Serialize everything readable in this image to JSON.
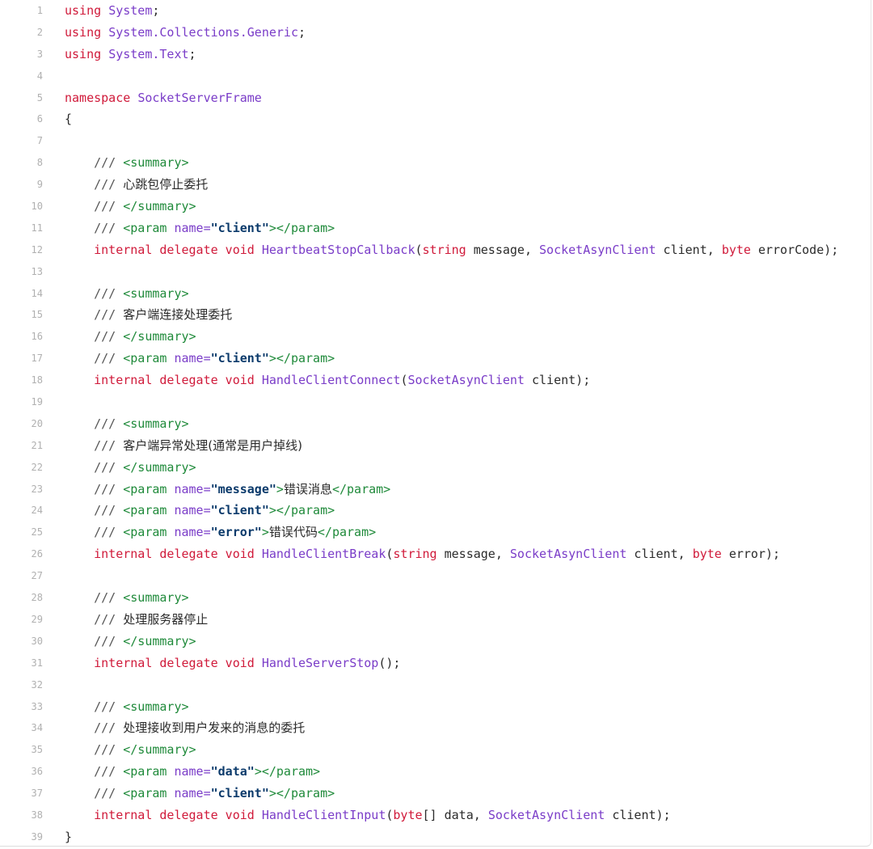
{
  "editor": {
    "language": "csharp",
    "colors": {
      "keyword": "#d01a3a",
      "type": "#7a3cc8",
      "doc_tag": "#1f8a3a",
      "string": "#0b3a6b",
      "line_number": "#b0b0b0",
      "text": "#2b2b2b"
    },
    "lines": [
      {
        "n": "1",
        "tokens": [
          {
            "t": "kw",
            "v": "using"
          },
          {
            "t": "id",
            "v": " "
          },
          {
            "t": "ns",
            "v": "System"
          },
          {
            "t": "punc",
            "v": ";"
          }
        ]
      },
      {
        "n": "2",
        "tokens": [
          {
            "t": "kw",
            "v": "using"
          },
          {
            "t": "id",
            "v": " "
          },
          {
            "t": "ns",
            "v": "System.Collections.Generic"
          },
          {
            "t": "punc",
            "v": ";"
          }
        ]
      },
      {
        "n": "3",
        "tokens": [
          {
            "t": "kw",
            "v": "using"
          },
          {
            "t": "id",
            "v": " "
          },
          {
            "t": "ns",
            "v": "System.Text"
          },
          {
            "t": "punc",
            "v": ";"
          }
        ]
      },
      {
        "n": "4",
        "tokens": []
      },
      {
        "n": "5",
        "tokens": [
          {
            "t": "kw",
            "v": "namespace"
          },
          {
            "t": "id",
            "v": " "
          },
          {
            "t": "ns",
            "v": "SocketServerFrame"
          }
        ]
      },
      {
        "n": "6",
        "tokens": [
          {
            "t": "punc",
            "v": "{"
          }
        ]
      },
      {
        "n": "7",
        "tokens": []
      },
      {
        "n": "8",
        "tokens": [
          {
            "t": "doc",
            "v": "    /// "
          },
          {
            "t": "tag",
            "v": "<summary>"
          }
        ]
      },
      {
        "n": "9",
        "tokens": [
          {
            "t": "doc",
            "v": "    /// "
          },
          {
            "t": "cn",
            "v": "心跳包停止委托"
          }
        ]
      },
      {
        "n": "10",
        "tokens": [
          {
            "t": "doc",
            "v": "    /// "
          },
          {
            "t": "tag",
            "v": "</summary>"
          }
        ]
      },
      {
        "n": "11",
        "tokens": [
          {
            "t": "doc",
            "v": "    /// "
          },
          {
            "t": "tag",
            "v": "<param "
          },
          {
            "t": "attr",
            "v": "name="
          },
          {
            "t": "str",
            "v": "\"client\""
          },
          {
            "t": "tag",
            "v": "></param>"
          }
        ]
      },
      {
        "n": "12",
        "tokens": [
          {
            "t": "id",
            "v": "    "
          },
          {
            "t": "kw",
            "v": "internal delegate void"
          },
          {
            "t": "id",
            "v": " "
          },
          {
            "t": "fn",
            "v": "HeartbeatStopCallback"
          },
          {
            "t": "punc",
            "v": "("
          },
          {
            "t": "kw",
            "v": "string"
          },
          {
            "t": "id",
            "v": " message, "
          },
          {
            "t": "type",
            "v": "SocketAsynClient"
          },
          {
            "t": "id",
            "v": " client, "
          },
          {
            "t": "kw",
            "v": "byte"
          },
          {
            "t": "id",
            "v": " errorCode);"
          }
        ]
      },
      {
        "n": "13",
        "tokens": []
      },
      {
        "n": "14",
        "tokens": [
          {
            "t": "doc",
            "v": "    /// "
          },
          {
            "t": "tag",
            "v": "<summary>"
          }
        ]
      },
      {
        "n": "15",
        "tokens": [
          {
            "t": "doc",
            "v": "    /// "
          },
          {
            "t": "cn",
            "v": "客户端连接处理委托"
          }
        ]
      },
      {
        "n": "16",
        "tokens": [
          {
            "t": "doc",
            "v": "    /// "
          },
          {
            "t": "tag",
            "v": "</summary>"
          }
        ]
      },
      {
        "n": "17",
        "tokens": [
          {
            "t": "doc",
            "v": "    /// "
          },
          {
            "t": "tag",
            "v": "<param "
          },
          {
            "t": "attr",
            "v": "name="
          },
          {
            "t": "str",
            "v": "\"client\""
          },
          {
            "t": "tag",
            "v": "></param>"
          }
        ]
      },
      {
        "n": "18",
        "tokens": [
          {
            "t": "id",
            "v": "    "
          },
          {
            "t": "kw",
            "v": "internal delegate void"
          },
          {
            "t": "id",
            "v": " "
          },
          {
            "t": "fn",
            "v": "HandleClientConnect"
          },
          {
            "t": "punc",
            "v": "("
          },
          {
            "t": "type",
            "v": "SocketAsynClient"
          },
          {
            "t": "id",
            "v": " client);"
          }
        ]
      },
      {
        "n": "19",
        "tokens": []
      },
      {
        "n": "20",
        "tokens": [
          {
            "t": "doc",
            "v": "    /// "
          },
          {
            "t": "tag",
            "v": "<summary>"
          }
        ]
      },
      {
        "n": "21",
        "tokens": [
          {
            "t": "doc",
            "v": "    /// "
          },
          {
            "t": "cn",
            "v": "客户端异常处理(通常是用户掉线)"
          }
        ]
      },
      {
        "n": "22",
        "tokens": [
          {
            "t": "doc",
            "v": "    /// "
          },
          {
            "t": "tag",
            "v": "</summary>"
          }
        ]
      },
      {
        "n": "23",
        "tokens": [
          {
            "t": "doc",
            "v": "    /// "
          },
          {
            "t": "tag",
            "v": "<param "
          },
          {
            "t": "attr",
            "v": "name="
          },
          {
            "t": "str",
            "v": "\"message\""
          },
          {
            "t": "tag",
            "v": ">"
          },
          {
            "t": "cn",
            "v": "错误消息"
          },
          {
            "t": "tag",
            "v": "</param>"
          }
        ]
      },
      {
        "n": "24",
        "tokens": [
          {
            "t": "doc",
            "v": "    /// "
          },
          {
            "t": "tag",
            "v": "<param "
          },
          {
            "t": "attr",
            "v": "name="
          },
          {
            "t": "str",
            "v": "\"client\""
          },
          {
            "t": "tag",
            "v": "></param>"
          }
        ]
      },
      {
        "n": "25",
        "tokens": [
          {
            "t": "doc",
            "v": "    /// "
          },
          {
            "t": "tag",
            "v": "<param "
          },
          {
            "t": "attr",
            "v": "name="
          },
          {
            "t": "str",
            "v": "\"error\""
          },
          {
            "t": "tag",
            "v": ">"
          },
          {
            "t": "cn",
            "v": "错误代码"
          },
          {
            "t": "tag",
            "v": "</param>"
          }
        ]
      },
      {
        "n": "26",
        "tokens": [
          {
            "t": "id",
            "v": "    "
          },
          {
            "t": "kw",
            "v": "internal delegate void"
          },
          {
            "t": "id",
            "v": " "
          },
          {
            "t": "fn",
            "v": "HandleClientBreak"
          },
          {
            "t": "punc",
            "v": "("
          },
          {
            "t": "kw",
            "v": "string"
          },
          {
            "t": "id",
            "v": " message, "
          },
          {
            "t": "type",
            "v": "SocketAsynClient"
          },
          {
            "t": "id",
            "v": " client, "
          },
          {
            "t": "kw",
            "v": "byte"
          },
          {
            "t": "id",
            "v": " error);"
          }
        ]
      },
      {
        "n": "27",
        "tokens": []
      },
      {
        "n": "28",
        "tokens": [
          {
            "t": "doc",
            "v": "    /// "
          },
          {
            "t": "tag",
            "v": "<summary>"
          }
        ]
      },
      {
        "n": "29",
        "tokens": [
          {
            "t": "doc",
            "v": "    /// "
          },
          {
            "t": "cn",
            "v": "处理服务器停止"
          }
        ]
      },
      {
        "n": "30",
        "tokens": [
          {
            "t": "doc",
            "v": "    /// "
          },
          {
            "t": "tag",
            "v": "</summary>"
          }
        ]
      },
      {
        "n": "31",
        "tokens": [
          {
            "t": "id",
            "v": "    "
          },
          {
            "t": "kw",
            "v": "internal delegate void"
          },
          {
            "t": "id",
            "v": " "
          },
          {
            "t": "fn",
            "v": "HandleServerStop"
          },
          {
            "t": "punc",
            "v": "();"
          }
        ]
      },
      {
        "n": "32",
        "tokens": []
      },
      {
        "n": "33",
        "tokens": [
          {
            "t": "doc",
            "v": "    /// "
          },
          {
            "t": "tag",
            "v": "<summary>"
          }
        ]
      },
      {
        "n": "34",
        "tokens": [
          {
            "t": "doc",
            "v": "    /// "
          },
          {
            "t": "cn",
            "v": "处理接收到用户发来的消息的委托"
          }
        ]
      },
      {
        "n": "35",
        "tokens": [
          {
            "t": "doc",
            "v": "    /// "
          },
          {
            "t": "tag",
            "v": "</summary>"
          }
        ]
      },
      {
        "n": "36",
        "tokens": [
          {
            "t": "doc",
            "v": "    /// "
          },
          {
            "t": "tag",
            "v": "<param "
          },
          {
            "t": "attr",
            "v": "name="
          },
          {
            "t": "str",
            "v": "\"data\""
          },
          {
            "t": "tag",
            "v": "></param>"
          }
        ]
      },
      {
        "n": "37",
        "tokens": [
          {
            "t": "doc",
            "v": "    /// "
          },
          {
            "t": "tag",
            "v": "<param "
          },
          {
            "t": "attr",
            "v": "name="
          },
          {
            "t": "str",
            "v": "\"client\""
          },
          {
            "t": "tag",
            "v": "></param>"
          }
        ]
      },
      {
        "n": "38",
        "tokens": [
          {
            "t": "id",
            "v": "    "
          },
          {
            "t": "kw",
            "v": "internal delegate void"
          },
          {
            "t": "id",
            "v": " "
          },
          {
            "t": "fn",
            "v": "HandleClientInput"
          },
          {
            "t": "punc",
            "v": "("
          },
          {
            "t": "kw",
            "v": "byte"
          },
          {
            "t": "id",
            "v": "[] data, "
          },
          {
            "t": "type",
            "v": "SocketAsynClient"
          },
          {
            "t": "id",
            "v": " client);"
          }
        ]
      },
      {
        "n": "39",
        "tokens": [
          {
            "t": "punc",
            "v": "}"
          }
        ]
      }
    ]
  }
}
